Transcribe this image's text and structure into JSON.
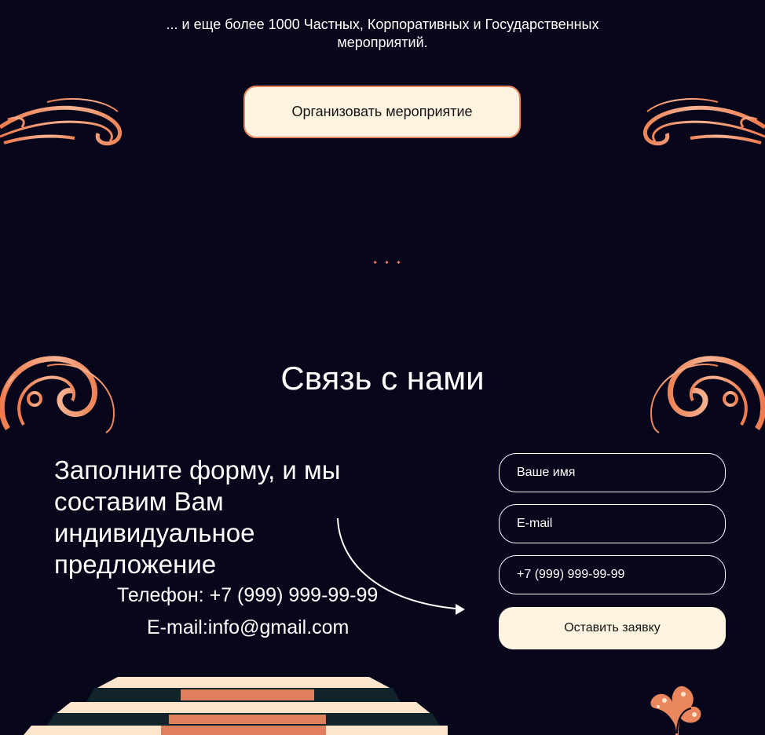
{
  "intro": {
    "line1": "... и еще более 1000 Частных, Корпоративных и Государственных",
    "line2": "мероприятий."
  },
  "organize_button": "Организовать мероприятие",
  "divider": "✦ ✦ ✦",
  "contact": {
    "title": "Связь с нами",
    "lead": "Заполните форму, и мы составим Вам индивидуальное предложение",
    "phone": "Телефон: +7 (999) 999-99-99",
    "email": "E-mail:info@gmail.com"
  },
  "form": {
    "name_placeholder": "Ваше имя",
    "email_placeholder": "E-mail",
    "phone_placeholder": "+7 (999) 999-99-99",
    "submit_label": "Оставить заявку"
  },
  "colors": {
    "background": "#07061a",
    "accent": "#e9865e",
    "cream": "#fdf3e0"
  },
  "icons": {
    "ornament": "swirl-ornament-icon",
    "arrow": "curved-arrow-icon",
    "stage": "stage-podium-illustration",
    "coral": "coral-ornament-icon"
  }
}
